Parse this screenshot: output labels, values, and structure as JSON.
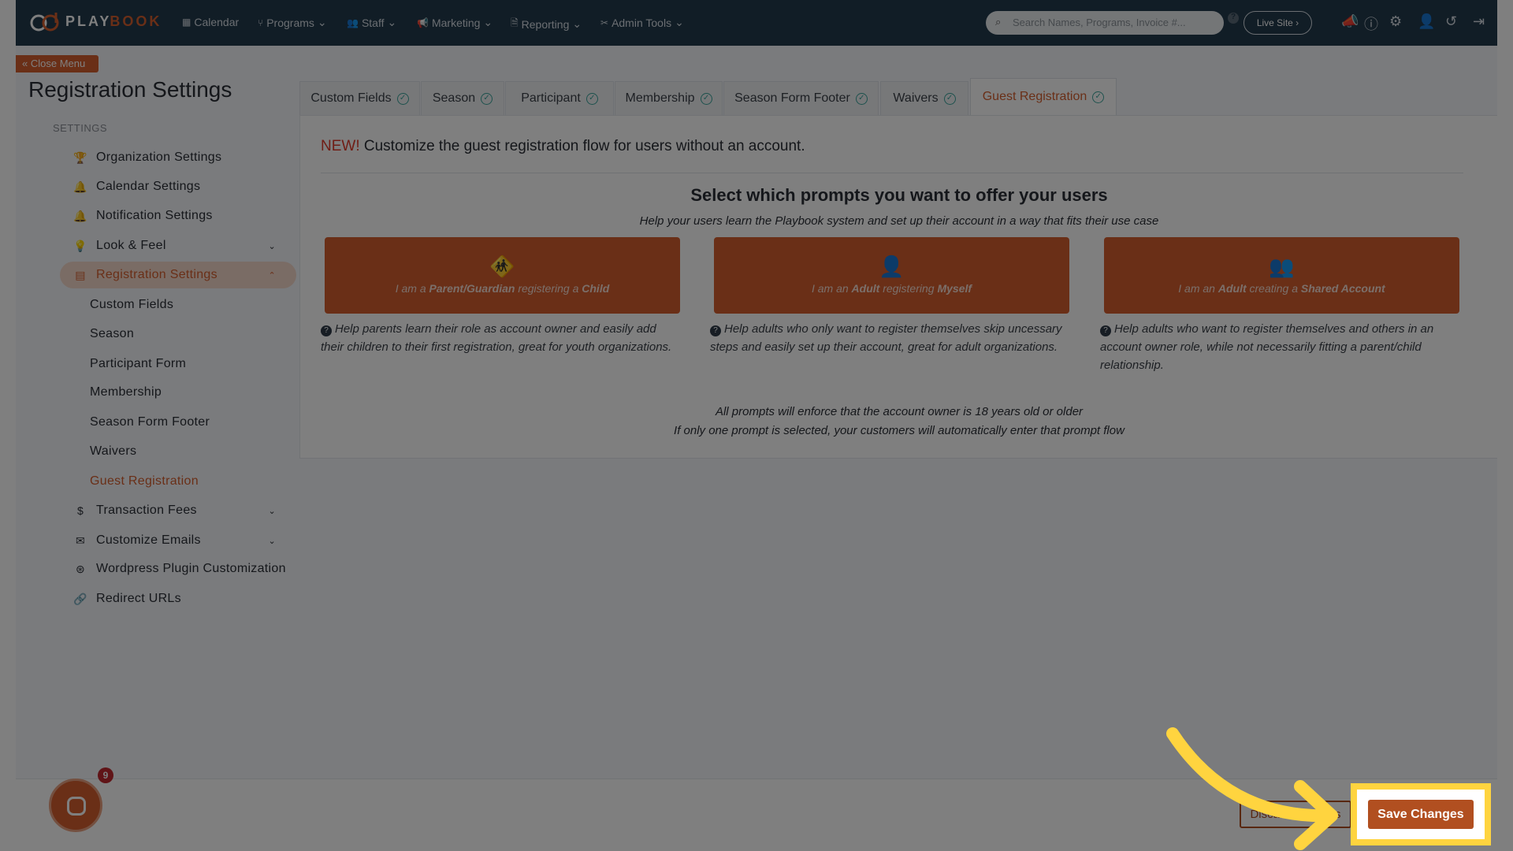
{
  "header": {
    "brand_play": "PLAY",
    "brand_book": "BOOK",
    "nav": [
      {
        "label": "Calendar",
        "icon": "calendar-icon",
        "glyph": "▦"
      },
      {
        "label": "Programs",
        "icon": "programs-icon",
        "glyph": "⑂",
        "dropdown": true
      },
      {
        "label": "Staff",
        "icon": "staff-icon",
        "glyph": "👥",
        "dropdown": true
      },
      {
        "label": "Marketing",
        "icon": "megaphone-icon",
        "glyph": "📢",
        "dropdown": true
      },
      {
        "label": "Reporting",
        "icon": "report-icon",
        "glyph": "🗎",
        "dropdown": true
      },
      {
        "label": "Admin Tools",
        "icon": "tools-icon",
        "glyph": "✂",
        "dropdown": true
      }
    ],
    "search_placeholder": "Search Names, Programs, Invoice #...",
    "live_site": "Live Site ›"
  },
  "sidebar": {
    "close_menu": "« Close Menu",
    "title": "Registration Settings",
    "section": "SETTINGS",
    "items": [
      {
        "label": "Organization Settings",
        "icon": "trophy-icon"
      },
      {
        "label": "Calendar Settings",
        "icon": "bell-icon"
      },
      {
        "label": "Notification Settings",
        "icon": "bell-icon"
      },
      {
        "label": "Look & Feel",
        "icon": "lightbulb-icon"
      },
      {
        "label": "Registration Settings",
        "icon": "form-icon"
      },
      {
        "label": "Custom Fields"
      },
      {
        "label": "Season"
      },
      {
        "label": "Participant Form"
      },
      {
        "label": "Membership"
      },
      {
        "label": "Season Form Footer"
      },
      {
        "label": "Waivers"
      },
      {
        "label": "Guest Registration"
      },
      {
        "label": "Transaction Fees",
        "icon": "dollar-icon"
      },
      {
        "label": "Customize Emails",
        "icon": "envelope-icon"
      },
      {
        "label": "Wordpress Plugin Customization",
        "icon": "wordpress-icon"
      },
      {
        "label": "Redirect URLs",
        "icon": "link-icon"
      }
    ]
  },
  "tabs": [
    "Custom Fields",
    "Season",
    "Participant",
    "Membership",
    "Season Form Footer",
    "Waivers",
    "Guest Registration"
  ],
  "main": {
    "new_tag": "NEW!",
    "new_text": " Customize the guest registration flow for users without an account.",
    "heading": "Select which prompts you want to offer your users",
    "subheading": "Help your users learn the Playbook system and set up their account in a way that fits their use case",
    "cards": [
      {
        "icon": "child-icon",
        "parts": [
          "I am a ",
          "Parent/Guardian",
          " registering a ",
          "Child"
        ],
        "desc": "Help parents learn their role as account owner and easily add their children to their first registration, great for youth organizations."
      },
      {
        "icon": "user-icon",
        "parts": [
          "I am an ",
          "Adult",
          " registering ",
          "Myself"
        ],
        "desc": "Help adults who only want to register themselves skip uncessary steps and easily set up their account, great for adult organizations."
      },
      {
        "icon": "users-icon",
        "parts": [
          "I am an ",
          "Adult",
          " creating a ",
          "Shared Account"
        ],
        "desc": "Help adults who want to register themselves and others in an account owner role, while not necessarily fitting a parent/child relationship."
      }
    ],
    "note1": "All prompts will enforce that the account owner is 18 years old or older",
    "note2": "If only one prompt is selected, your customers will automatically enter that prompt flow"
  },
  "footer": {
    "cancel": "Discard Changes",
    "save": "Save Changes",
    "chat_badge": "9"
  },
  "colors": {
    "brand": "#d45e2e",
    "save": "#b14f20",
    "highlight": "#ffd43f",
    "header": "#223a4c"
  }
}
